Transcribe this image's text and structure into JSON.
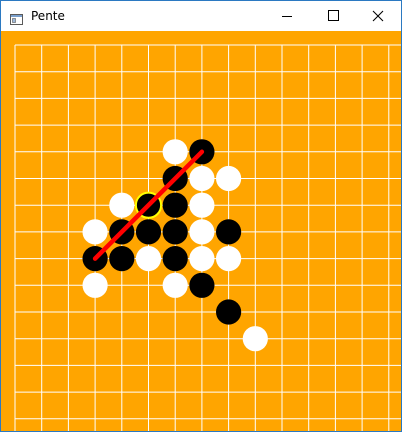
{
  "window": {
    "title": "Pente",
    "icon": "app-window-icon",
    "controls": {
      "minimize_icon": "minimize-icon",
      "maximize_icon": "maximize-icon",
      "close_icon": "close-icon"
    }
  },
  "colors": {
    "board": "#ffa500",
    "grid": "#ffffff",
    "black_stone": "#000000",
    "white_stone": "#ffffff",
    "last_move_ring": "#ffff00",
    "winning_line": "#ff0000"
  },
  "board": {
    "size": 15,
    "stones": [
      {
        "col": 5,
        "row": 3,
        "color": "white"
      },
      {
        "col": 6,
        "row": 3,
        "color": "black"
      },
      {
        "col": 5,
        "row": 4,
        "color": "black"
      },
      {
        "col": 6,
        "row": 4,
        "color": "white"
      },
      {
        "col": 7,
        "row": 4,
        "color": "white"
      },
      {
        "col": 3,
        "row": 5,
        "color": "white"
      },
      {
        "col": 4,
        "row": 5,
        "color": "black",
        "last_move": true
      },
      {
        "col": 5,
        "row": 5,
        "color": "black"
      },
      {
        "col": 6,
        "row": 5,
        "color": "white"
      },
      {
        "col": 2,
        "row": 6,
        "color": "white"
      },
      {
        "col": 3,
        "row": 6,
        "color": "black"
      },
      {
        "col": 4,
        "row": 6,
        "color": "black"
      },
      {
        "col": 5,
        "row": 6,
        "color": "black"
      },
      {
        "col": 6,
        "row": 6,
        "color": "white"
      },
      {
        "col": 7,
        "row": 6,
        "color": "black"
      },
      {
        "col": 2,
        "row": 7,
        "color": "black"
      },
      {
        "col": 3,
        "row": 7,
        "color": "black"
      },
      {
        "col": 4,
        "row": 7,
        "color": "white"
      },
      {
        "col": 5,
        "row": 7,
        "color": "black"
      },
      {
        "col": 6,
        "row": 7,
        "color": "white"
      },
      {
        "col": 7,
        "row": 7,
        "color": "white"
      },
      {
        "col": 2,
        "row": 8,
        "color": "white"
      },
      {
        "col": 5,
        "row": 8,
        "color": "white"
      },
      {
        "col": 6,
        "row": 8,
        "color": "black"
      },
      {
        "col": 7,
        "row": 9,
        "color": "black"
      },
      {
        "col": 8,
        "row": 10,
        "color": "white"
      }
    ],
    "winning_line": {
      "from": {
        "col": 2,
        "row": 7
      },
      "to": {
        "col": 6,
        "row": 3
      }
    }
  }
}
